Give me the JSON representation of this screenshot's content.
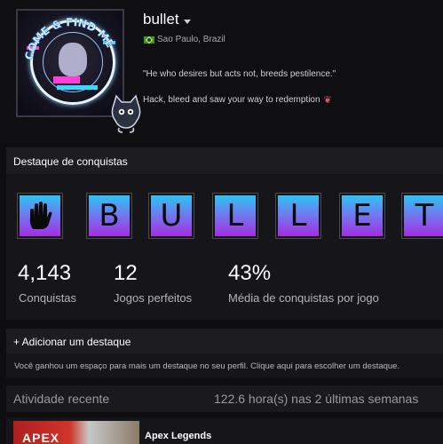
{
  "profile": {
    "username": "bullet",
    "location": "Sao Paulo, Brazil",
    "quote": "\"He who desires but acts not, breeds pestilence.\"",
    "tagline": "Hack, bleed and saw your way to redemption",
    "avatar_text": "COME & FIND ME"
  },
  "achievement_showcase": {
    "title": "Destaque de conquistas",
    "tiles": [
      "✋",
      "B",
      "U",
      "L",
      "L",
      "E",
      "T"
    ],
    "stats": [
      {
        "value": "4,143",
        "label": "Conquistas"
      },
      {
        "value": "12",
        "label": "Jogos perfeitos"
      },
      {
        "value": "43%",
        "label": "Média de conquistas por jogo"
      }
    ]
  },
  "add_showcase": {
    "title": "+ Adicionar um destaque",
    "description": "Você ganhou um espaço para mais um destaque no seu perfil. Clique aqui para escolher um destaque."
  },
  "recent_activity": {
    "title": "Atividade recente",
    "hours": "122.6 hora(s) nas 2 últimas semanas"
  },
  "games": [
    {
      "name": "Apex Legends",
      "logo": "APEX"
    }
  ],
  "colors": {
    "background": "#0e0e10",
    "panel": "#16161a",
    "tile_top": "#2cc4f3",
    "tile_bottom": "#a42ee3"
  }
}
